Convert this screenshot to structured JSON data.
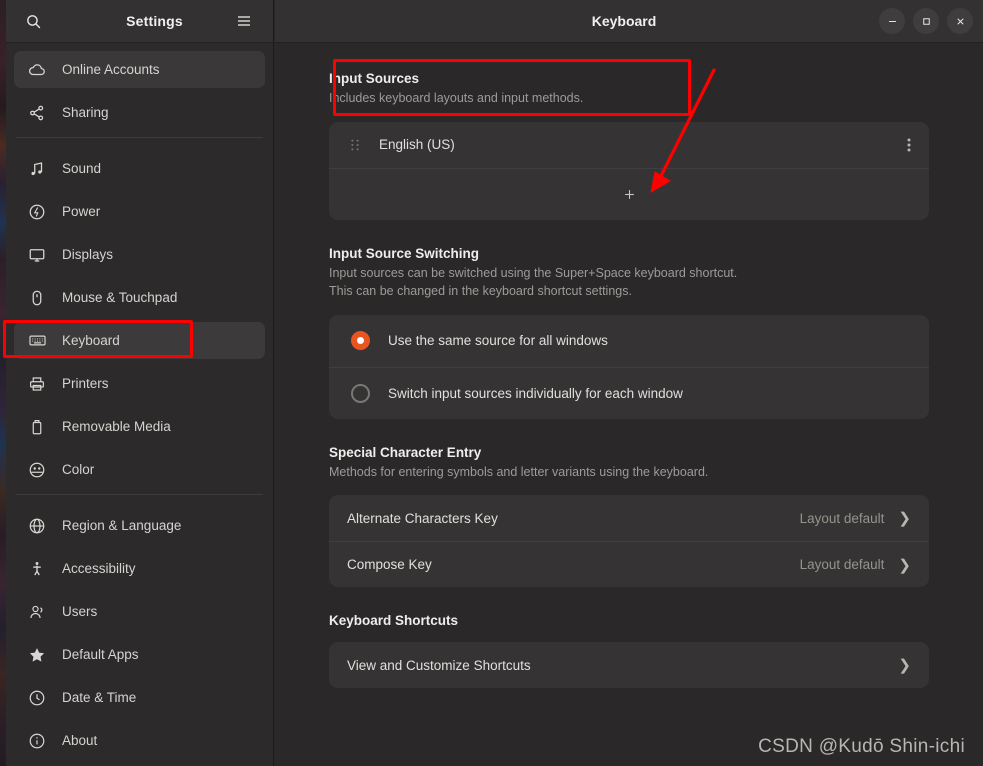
{
  "accent_color": "#e95420",
  "annotation_color": "#ff0000",
  "sidebar": {
    "title": "Settings",
    "search_icon": "search-icon",
    "menu_icon": "hamburger-menu-icon",
    "groups": [
      {
        "items": [
          {
            "label": "Online Accounts",
            "icon": "cloud-icon",
            "state": "hovered"
          },
          {
            "label": "Sharing",
            "icon": "share-nodes-icon",
            "state": "normal"
          }
        ]
      },
      {
        "items": [
          {
            "label": "Sound",
            "icon": "music-note-icon",
            "state": "normal"
          },
          {
            "label": "Power",
            "icon": "power-icon",
            "state": "normal"
          },
          {
            "label": "Displays",
            "icon": "monitor-icon",
            "state": "normal"
          },
          {
            "label": "Mouse & Touchpad",
            "icon": "mouse-icon",
            "state": "normal"
          },
          {
            "label": "Keyboard",
            "icon": "keyboard-icon",
            "state": "selected"
          },
          {
            "label": "Printers",
            "icon": "printer-icon",
            "state": "normal"
          },
          {
            "label": "Removable Media",
            "icon": "usb-drive-icon",
            "state": "normal"
          },
          {
            "label": "Color",
            "icon": "color-wheel-icon",
            "state": "normal"
          }
        ]
      },
      {
        "items": [
          {
            "label": "Region & Language",
            "icon": "globe-icon",
            "state": "normal"
          },
          {
            "label": "Accessibility",
            "icon": "accessibility-person-icon",
            "state": "normal"
          },
          {
            "label": "Users",
            "icon": "users-icon",
            "state": "normal"
          },
          {
            "label": "Default Apps",
            "icon": "star-icon",
            "state": "normal"
          },
          {
            "label": "Date & Time",
            "icon": "clock-icon",
            "state": "normal"
          },
          {
            "label": "About",
            "icon": "info-circle-icon",
            "state": "normal"
          }
        ]
      }
    ]
  },
  "window": {
    "title": "Keyboard",
    "minimize_label": "–",
    "maximize_label": "□",
    "close_label": "✕"
  },
  "input_sources": {
    "heading": "Input Sources",
    "description": "Includes keyboard layouts and input methods.",
    "sources": [
      {
        "name": "English (US)",
        "drag_icon": "drag-handle-icon",
        "menu_icon": "kebab-menu-icon"
      }
    ],
    "add_label": "+"
  },
  "input_source_switching": {
    "heading": "Input Source Switching",
    "description_line1": "Input sources can be switched using the Super+Space keyboard shortcut.",
    "description_line2": "This can be changed in the keyboard shortcut settings.",
    "options": [
      {
        "label": "Use the same source for all windows",
        "selected": true
      },
      {
        "label": "Switch input sources individually for each window",
        "selected": false
      }
    ]
  },
  "special_character_entry": {
    "heading": "Special Character Entry",
    "description": "Methods for entering symbols and letter variants using the keyboard.",
    "rows": [
      {
        "label": "Alternate Characters Key",
        "value": "Layout default",
        "chevron": "❯"
      },
      {
        "label": "Compose Key",
        "value": "Layout default",
        "chevron": "❯"
      }
    ]
  },
  "keyboard_shortcuts": {
    "heading": "Keyboard Shortcuts",
    "rows": [
      {
        "label": "View and Customize Shortcuts",
        "chevron": "❯"
      }
    ]
  },
  "watermark": {
    "text": "CSDN @Kudō Shin-ichi"
  }
}
